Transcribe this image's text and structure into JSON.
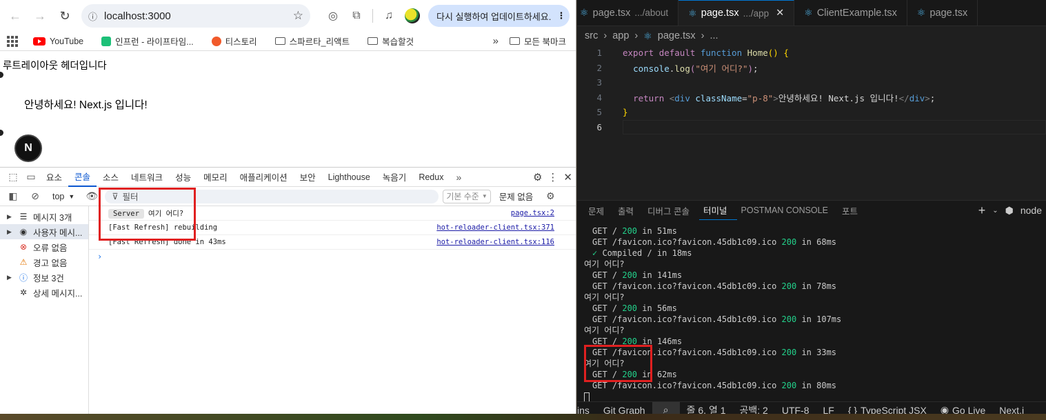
{
  "browser": {
    "url": "localhost:3000",
    "update_text": "다시 실행하여 업데이트하세요.",
    "bookmarks": [
      {
        "label": "YouTube"
      },
      {
        "label": "인프런 - 라이프타임..."
      },
      {
        "label": "티스토리"
      },
      {
        "label": "스파르타_리액트"
      },
      {
        "label": "복습할것"
      }
    ],
    "all_bookmarks": "모든 북마크",
    "page": {
      "header": "루트레이아웃 헤더입니다",
      "hello": "안녕하세요! Next.js 입니다!",
      "next_badge": "N"
    }
  },
  "devtools": {
    "tabs": [
      "요소",
      "콘솔",
      "소스",
      "네트워크",
      "성능",
      "메모리",
      "애플리케이션",
      "보안",
      "Lighthouse",
      "녹음기",
      "Redux"
    ],
    "active_tab": "콘솔",
    "context": "top",
    "filter_placeholder": "필터",
    "level": "기본 수준",
    "issues": "문제 없음",
    "sidebar": [
      {
        "label": "메시지 3개",
        "icon": "list-icon"
      },
      {
        "label": "사용자 메시...",
        "icon": "user-icon"
      },
      {
        "label": "오류 없음",
        "icon": "error-icon"
      },
      {
        "label": "경고 없음",
        "icon": "warning-icon"
      },
      {
        "label": "정보 3건",
        "icon": "info-icon"
      },
      {
        "label": "상세 메시지...",
        "icon": "bug-icon"
      }
    ],
    "logs": [
      {
        "badge": "Server",
        "message": "여기 어디?",
        "source": "page.tsx:2"
      },
      {
        "message": "[Fast Refresh] rebuilding",
        "source": "hot-reloader-client.tsx:371"
      },
      {
        "message": "[Fast Refresh] done in 43ms",
        "source": "hot-reloader-client.tsx:116"
      }
    ]
  },
  "vscode": {
    "tabs": [
      {
        "name": "page.tsx",
        "path": ".../about"
      },
      {
        "name": "page.tsx",
        "path": ".../app"
      },
      {
        "name": "ClientExample.tsx",
        "path": ""
      },
      {
        "name": "page.tsx",
        "path": ""
      }
    ],
    "breadcrumb": [
      "src",
      "app",
      "page.tsx",
      "..."
    ],
    "line_numbers": [
      "1",
      "2",
      "3",
      "4",
      "5",
      "6"
    ],
    "panel_tabs": [
      "문제",
      "출력",
      "디버그 콘솔",
      "터미널",
      "POSTMAN CONSOLE",
      "포트"
    ],
    "active_panel_tab": "터미널",
    "terminal_shell": "node",
    "terminal": [
      {
        "pre": "GET / ",
        "code": "200",
        "post": " in 51ms",
        "kind": "get"
      },
      {
        "pre": "GET /favicon.ico?favicon.45db1c09.ico ",
        "code": "200",
        "post": " in 68ms",
        "kind": "get"
      },
      {
        "pre": "✓",
        "code": "",
        "post": " Compiled / in 18ms",
        "kind": "compiled"
      },
      {
        "pre": "여기 어디?",
        "code": "",
        "post": "",
        "kind": "log"
      },
      {
        "pre": "GET / ",
        "code": "200",
        "post": " in 141ms",
        "kind": "get"
      },
      {
        "pre": "GET /favicon.ico?favicon.45db1c09.ico ",
        "code": "200",
        "post": " in 78ms",
        "kind": "get"
      },
      {
        "pre": "여기 어디?",
        "code": "",
        "post": "",
        "kind": "log"
      },
      {
        "pre": "GET / ",
        "code": "200",
        "post": " in 56ms",
        "kind": "get"
      },
      {
        "pre": "GET /favicon.ico?favicon.45db1c09.ico ",
        "code": "200",
        "post": " in 107ms",
        "kind": "get"
      },
      {
        "pre": "여기 어디?",
        "code": "",
        "post": "",
        "kind": "log"
      },
      {
        "pre": "GET / ",
        "code": "200",
        "post": " in 146ms",
        "kind": "get"
      },
      {
        "pre": "GET /favicon.ico?favicon.45db1c09.ico ",
        "code": "200",
        "post": " in 33ms",
        "kind": "get"
      },
      {
        "pre": "여기 어디?",
        "code": "",
        "post": "",
        "kind": "log"
      },
      {
        "pre": "GET / ",
        "code": "200",
        "post": " in 62ms",
        "kind": "get"
      },
      {
        "pre": "GET /favicon.ico?favicon.45db1c09.ico ",
        "code": "200",
        "post": " in 80ms",
        "kind": "get"
      }
    ],
    "statusbar": {
      "ins": "ins",
      "git_graph": "Git Graph",
      "position": "줄 6, 열 1",
      "spaces": "공백: 2",
      "encoding": "UTF-8",
      "eol": "LF",
      "language": "TypeScript JSX",
      "golive": "Go Live",
      "next": "Next.j"
    },
    "highlight_color": "#e02020"
  }
}
